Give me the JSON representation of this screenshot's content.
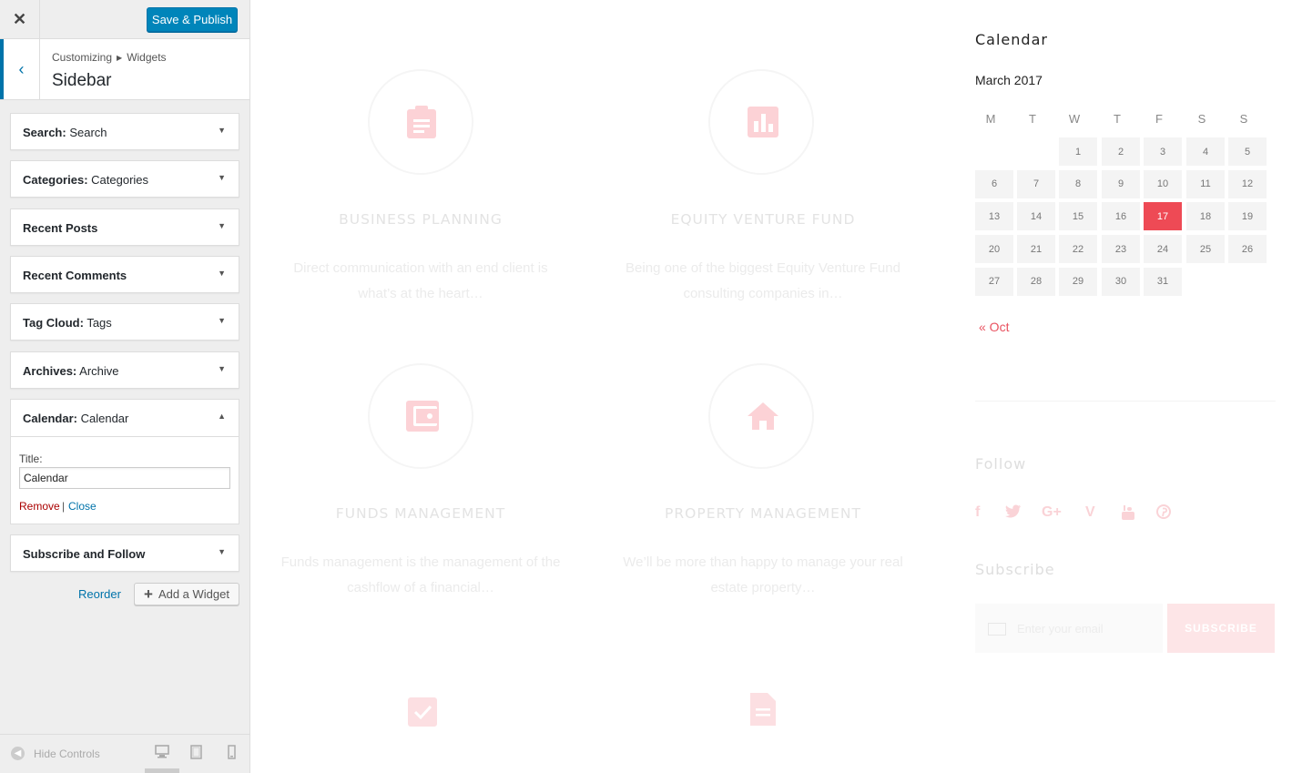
{
  "toolbar": {
    "save_label": "Save & Publish"
  },
  "section": {
    "breadcrumb_root": "Customizing",
    "breadcrumb_child": "Widgets",
    "title": "Sidebar"
  },
  "widgets": [
    {
      "type": "Search",
      "title": "Search"
    },
    {
      "type": "Categories",
      "title": "Categories"
    },
    {
      "type": "Recent Posts",
      "title": ""
    },
    {
      "type": "Recent Comments",
      "title": ""
    },
    {
      "type": "Tag Cloud",
      "title": "Tags"
    },
    {
      "type": "Archives",
      "title": "Archive"
    },
    {
      "type": "Calendar",
      "title": "Calendar"
    },
    {
      "type": "Subscribe and Follow",
      "title": ""
    }
  ],
  "calendar_widget": {
    "field_label": "Title:",
    "field_value": "Calendar",
    "remove_label": "Remove",
    "separator": "|",
    "close_label": "Close"
  },
  "actions": {
    "reorder_label": "Reorder",
    "add_widget_label": "Add a Widget"
  },
  "footer": {
    "hide_controls_label": "Hide Controls"
  },
  "preview": {
    "services": [
      {
        "title": "BUSINESS PLANNING",
        "desc_line1": "Direct communication with an end client is",
        "desc_line2": "what’s at the heart…",
        "icon": "clipboard-icon"
      },
      {
        "title": "EQUITY VENTURE FUND",
        "desc_line1": "Being one of the biggest Equity Venture Fund",
        "desc_line2": "consulting companies in…",
        "icon": "bar-chart-icon"
      },
      {
        "title": "FUNDS MANAGEMENT",
        "desc_line1": "Funds management is the management of the",
        "desc_line2": "cashflow of a financial…",
        "icon": "wallet-icon"
      },
      {
        "title": "PROPERTY MANAGEMENT",
        "desc_line1": "We’ll be more than happy to manage your real",
        "desc_line2": "estate property…",
        "icon": "home-icon"
      }
    ],
    "calendar": {
      "heading": "Calendar",
      "month": "March 2017",
      "weekdays": [
        "M",
        "T",
        "W",
        "T",
        "F",
        "S",
        "S"
      ],
      "days": [
        "1",
        "2",
        "3",
        "4",
        "5",
        "6",
        "7",
        "8",
        "9",
        "10",
        "11",
        "12",
        "13",
        "14",
        "15",
        "16",
        "17",
        "18",
        "19",
        "20",
        "21",
        "22",
        "23",
        "24",
        "25",
        "26",
        "27",
        "28",
        "29",
        "30",
        "31"
      ],
      "today": "17",
      "prev_link": "« Oct"
    },
    "follow": {
      "heading": "Follow",
      "networks": [
        "facebook-icon",
        "twitter-icon",
        "google-plus-icon",
        "vimeo-icon",
        "youtube-icon",
        "pinterest-icon"
      ]
    },
    "subscribe": {
      "heading": "Subscribe",
      "placeholder": "Enter your email",
      "button": "SUBSCRIBE"
    }
  },
  "colors": {
    "accent": "#0085ba",
    "link": "#0073aa",
    "remove": "#aa0000",
    "today": "#ee4a55"
  }
}
